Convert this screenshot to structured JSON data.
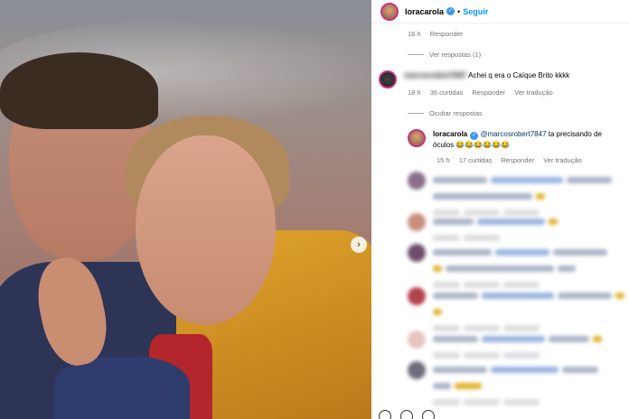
{
  "header": {
    "username": "loracarola",
    "separator": "•",
    "follow_label": "Seguir"
  },
  "top_meta": {
    "time": "16 h",
    "reply": "Responder"
  },
  "view_replies_1": "Ver respostas (1)",
  "comment_1": {
    "username": "marcosrobert7847",
    "text": "Achei q era o Caíque Brito kkkk",
    "time": "18 h",
    "likes": "36 curtidas",
    "reply": "Responder",
    "translate": "Ver tradução"
  },
  "hide_replies": "Ocultar respostas",
  "reply_1": {
    "username": "loracarola",
    "mention": "@marcosrobert7847",
    "text": "ta precisando de óculos 😂😂😂😂😂😂",
    "time": "15 h",
    "likes": "17 curtidas",
    "reply": "Responder",
    "translate": "Ver tradução"
  },
  "colors": {
    "accent": "#0095f6",
    "verified": "#3897f0",
    "avatar_ring": "#c13584"
  }
}
